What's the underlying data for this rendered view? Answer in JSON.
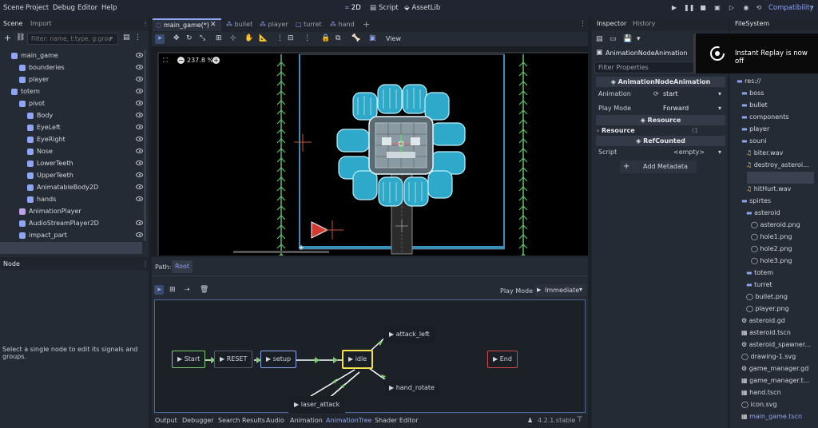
{
  "menu": {
    "items": [
      "Scene",
      "Project",
      "Debug",
      "Editor",
      "Help"
    ],
    "workspaces": [
      "2D",
      "Script",
      "AssetLib"
    ],
    "renderer": "Compatibility"
  },
  "scene_dock": {
    "tabs": [
      "Scene",
      "Import"
    ],
    "filter_placeholder": "Filter: name, t:type, g:grou",
    "nodes": [
      {
        "label": "main_game",
        "indent": 0,
        "color": "#8da5f3",
        "eye": true
      },
      {
        "label": "bounderies",
        "indent": 1,
        "color": "#8da5f3",
        "eye": true
      },
      {
        "label": "player",
        "indent": 1,
        "color": "#8da5f3",
        "eye": true
      },
      {
        "label": "totem",
        "indent": 0,
        "color": "#8da5f3",
        "eye": true
      },
      {
        "label": "pivot",
        "indent": 1,
        "color": "#8da5f3",
        "eye": true
      },
      {
        "label": "Body",
        "indent": 2,
        "color": "#8da5f3",
        "eye": true
      },
      {
        "label": "EyeLeft",
        "indent": 2,
        "color": "#8da5f3",
        "eye": true
      },
      {
        "label": "EyeRight",
        "indent": 2,
        "color": "#8da5f3",
        "eye": true
      },
      {
        "label": "Nose",
        "indent": 2,
        "color": "#8da5f3",
        "eye": true
      },
      {
        "label": "LowerTeeth",
        "indent": 2,
        "color": "#8da5f3",
        "eye": true
      },
      {
        "label": "UpperTeeth",
        "indent": 2,
        "color": "#8da5f3",
        "eye": true
      },
      {
        "label": "AnimatableBody2D",
        "indent": 2,
        "color": "#8da5f3",
        "eye": true
      },
      {
        "label": "hands",
        "indent": 2,
        "color": "#8da5f3",
        "eye": true
      },
      {
        "label": "AnimationPlayer",
        "indent": 1,
        "color": "#c0a0e8",
        "eye": false
      },
      {
        "label": "AudioStreamPlayer2D",
        "indent": 1,
        "color": "#8da5f3",
        "eye": true
      },
      {
        "label": "impact_part",
        "indent": 1,
        "color": "#8da5f3",
        "eye": true
      },
      {
        "label": "AnimationTree",
        "indent": 1,
        "color": "#c0a0e8",
        "eye": false
      }
    ]
  },
  "node_dock": {
    "tab": "Node",
    "message": "Select a single node to edit its signals and groups."
  },
  "editor_tabs": [
    "main_game(*)",
    "bullet",
    "player",
    "turret",
    "hand"
  ],
  "viewport": {
    "zoom": "237.8 %",
    "view_label": "View"
  },
  "animation_tree": {
    "path_label": "Path:",
    "path_root": "Root",
    "play_mode_label": "Play Mode:",
    "play_mode_value": "Immediate",
    "nodes": [
      "Start",
      "RESET",
      "setup",
      "idle",
      "End",
      "attack_left",
      "hand_rotate",
      "laser_attack"
    ]
  },
  "bottom_panel": {
    "tabs": [
      "Output",
      "Debugger",
      "Search Results",
      "Audio",
      "Animation",
      "AnimationTree",
      "Shader Editor"
    ],
    "version": "4.2.1.stable"
  },
  "inspector": {
    "tabs": [
      "Inspector",
      "History"
    ],
    "object_name": "AnimationNodeAnimation",
    "filter_placeholder": "Filter Properties",
    "section_title": "AnimationNodeAnimation",
    "props": [
      {
        "name": "Animation",
        "value": "start"
      },
      {
        "name": "Play Mode",
        "value": "Forward"
      }
    ],
    "resource_header": "Resource",
    "resource_label": "Resource",
    "resource_changes": "(1 change)",
    "refcounted_header": "RefCounted",
    "script_label": "Script",
    "script_value": "<empty>",
    "add_metadata": "Add Metadata"
  },
  "filesystem": {
    "tab": "FileSystem",
    "items": [
      {
        "label": "res://",
        "indent": 0,
        "kind": "folder"
      },
      {
        "label": "boss",
        "indent": 1,
        "kind": "folder"
      },
      {
        "label": "bullet",
        "indent": 1,
        "kind": "folder"
      },
      {
        "label": "components",
        "indent": 1,
        "kind": "folder"
      },
      {
        "label": "player",
        "indent": 1,
        "kind": "folder"
      },
      {
        "label": "souni",
        "indent": 1,
        "kind": "folder"
      },
      {
        "label": "biter.wav",
        "indent": 2,
        "kind": "audio"
      },
      {
        "label": "destroy_asteroi...",
        "indent": 2,
        "kind": "audio"
      },
      {
        "label": "destrsoy_astero...",
        "indent": 2,
        "kind": "audio"
      },
      {
        "label": "hitHurt.wav",
        "indent": 2,
        "kind": "audio"
      },
      {
        "label": "spirtes",
        "indent": 1,
        "kind": "folder"
      },
      {
        "label": "asteroid",
        "indent": 2,
        "kind": "folder"
      },
      {
        "label": "asteroid.png",
        "indent": 3,
        "kind": "image"
      },
      {
        "label": "hole1.png",
        "indent": 3,
        "kind": "image"
      },
      {
        "label": "hole2.png",
        "indent": 3,
        "kind": "image"
      },
      {
        "label": "hole3.png",
        "indent": 3,
        "kind": "image"
      },
      {
        "label": "totem",
        "indent": 2,
        "kind": "folder"
      },
      {
        "label": "turret",
        "indent": 2,
        "kind": "folder"
      },
      {
        "label": "bullet.png",
        "indent": 2,
        "kind": "image"
      },
      {
        "label": "player.png",
        "indent": 2,
        "kind": "image"
      },
      {
        "label": "asteroid.gd",
        "indent": 1,
        "kind": "script"
      },
      {
        "label": "asteroid.tscn",
        "indent": 1,
        "kind": "scene"
      },
      {
        "label": "asteroid_spawner...",
        "indent": 1,
        "kind": "script"
      },
      {
        "label": "drawing-1.svg",
        "indent": 1,
        "kind": "image"
      },
      {
        "label": "game_manager.gd",
        "indent": 1,
        "kind": "script"
      },
      {
        "label": "game_manager.t...",
        "indent": 1,
        "kind": "scene"
      },
      {
        "label": "hand.tscn",
        "indent": 1,
        "kind": "scene"
      },
      {
        "label": "icon.svg",
        "indent": 1,
        "kind": "image"
      },
      {
        "label": "main_game.tscn",
        "indent": 1,
        "kind": "scene"
      }
    ]
  },
  "notification": {
    "text": "Instant Replay is now off"
  }
}
